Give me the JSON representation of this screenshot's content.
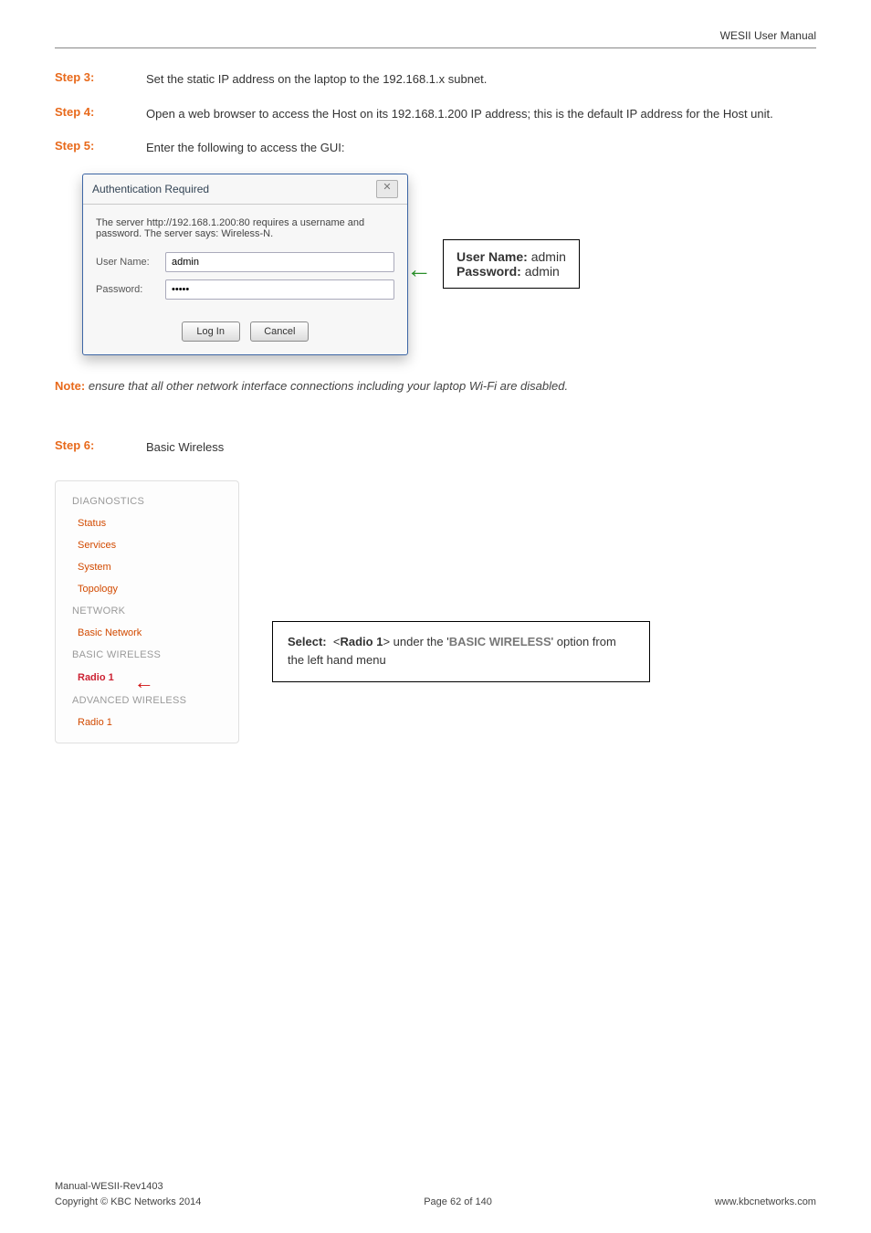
{
  "header": {
    "title": "WESII User Manual"
  },
  "steps": {
    "s3": {
      "label": "Step 3:",
      "text": "Set the static IP address on the laptop to the 192.168.1.x subnet."
    },
    "s4": {
      "label": "Step 4:",
      "text": "Open a web browser to access the Host on its 192.168.1.200 IP address; this is the default IP address for the Host unit."
    },
    "s5": {
      "label": "Step 5:",
      "text": "Enter the following to access the GUI:"
    },
    "s6": {
      "label": "Step 6:",
      "text": "Basic Wireless"
    }
  },
  "dialog": {
    "title": "Authentication Required",
    "message": "The server http://192.168.1.200:80 requires a username and password. The server says: Wireless-N.",
    "user_label": "User Name:",
    "user_value": "admin",
    "pw_label": "Password:",
    "pw_value": "•••••",
    "login_label": "Log In",
    "cancel_label": "Cancel"
  },
  "credentials": {
    "user_label": "User Name:",
    "user_value": "admin",
    "pw_label": "Password:",
    "pw_value": "admin"
  },
  "note": {
    "prefix": "Note:",
    "text": "ensure that all other network interface connections including your laptop Wi-Fi are disabled."
  },
  "menu": {
    "diagnostics": "DIAGNOSTICS",
    "status": "Status",
    "services": "Services",
    "system": "System",
    "topology": "Topology",
    "network": "NETWORK",
    "basic_network": "Basic Network",
    "basic_wireless": "BASIC WIRELESS",
    "radio1": "Radio 1",
    "adv_wireless": "ADVANCED WIRELESS",
    "adv_radio1": "Radio 1"
  },
  "select_box": {
    "select_label": "Select:",
    "radio_ref": "<Radio 1>",
    "under_text": "under the '",
    "basic_wireless_kw": "BASIC WIRELESS",
    "suffix": "' option from the left hand menu"
  },
  "footer": {
    "left1": "Manual-WESII-Rev1403",
    "left2": "Copyright © KBC Networks 2014",
    "center": "Page 62 of 140",
    "right": "www.kbcnetworks.com"
  }
}
